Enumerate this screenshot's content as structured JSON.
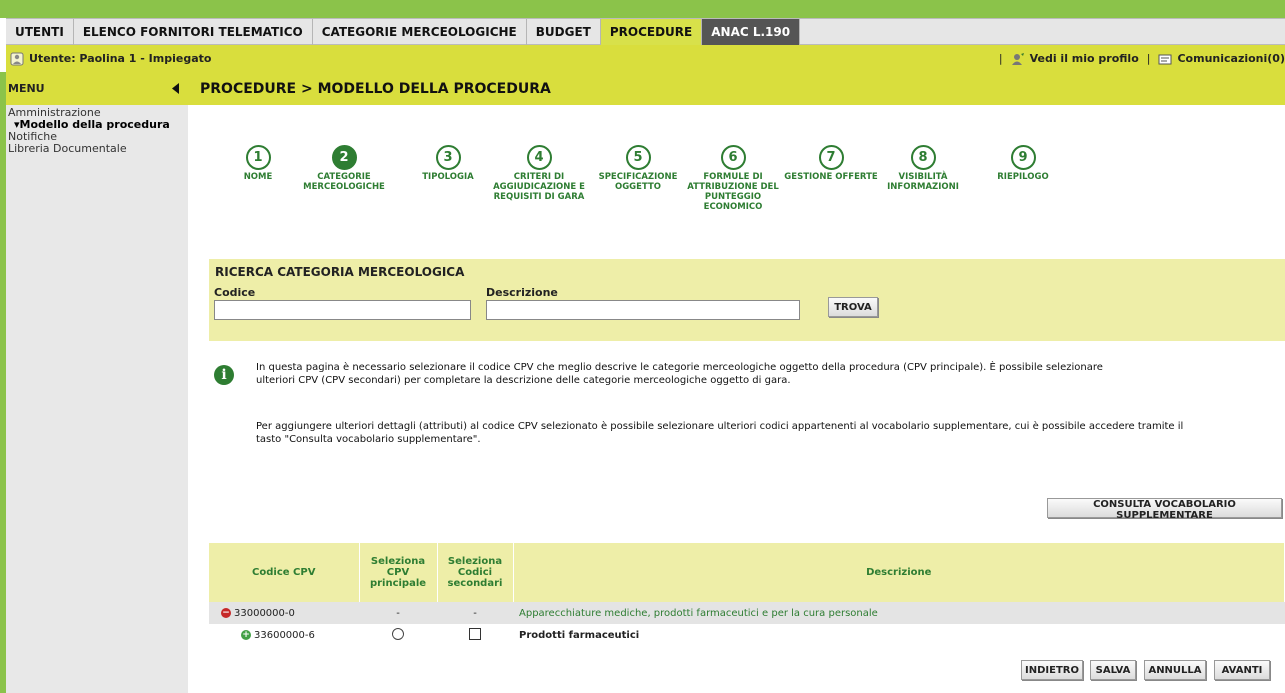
{
  "topnav": {
    "tabs": [
      {
        "label": "UTENTI"
      },
      {
        "label": "ELENCO FORNITORI TELEMATICO"
      },
      {
        "label": "CATEGORIE MERCEOLOGICHE"
      },
      {
        "label": "BUDGET"
      },
      {
        "label": "PROCEDURE"
      },
      {
        "label": "ANAC L.190"
      }
    ]
  },
  "userbar": {
    "user": "Utente: Paolina 1 - Impiegato",
    "profile": "Vedi il mio profilo",
    "messages": "Comunicazioni(0)"
  },
  "sidebar": {
    "menu": "MENU",
    "items": [
      {
        "label": "Amministrazione"
      },
      {
        "label": "▾Modello della procedura"
      },
      {
        "label": "Notifiche"
      },
      {
        "label": "Libreria Documentale"
      }
    ]
  },
  "page": {
    "title": "PROCEDURE  > MODELLO DELLA PROCEDURA"
  },
  "steps": [
    {
      "num": "1",
      "label": "NOME"
    },
    {
      "num": "2",
      "label": "CATEGORIE MERCEOLOGICHE"
    },
    {
      "num": "3",
      "label": "TIPOLOGIA"
    },
    {
      "num": "4",
      "label": "CRITERI DI AGGIUDICAZIONE E REQUISITI DI GARA"
    },
    {
      "num": "5",
      "label": "SPECIFICAZIONE OGGETTO"
    },
    {
      "num": "6",
      "label": "FORMULE DI ATTRIBUZIONE DEL PUNTEGGIO ECONOMICO"
    },
    {
      "num": "7",
      "label": "GESTIONE OFFERTE"
    },
    {
      "num": "8",
      "label": "VISIBILITÀ INFORMAZIONI"
    },
    {
      "num": "9",
      "label": "RIEPILOGO"
    }
  ],
  "search": {
    "title": "RICERCA CATEGORIA MERCEOLOGICA",
    "code_label": "Codice",
    "code_value": "",
    "desc_label": "Descrizione",
    "desc_value": "",
    "button": "TROVA"
  },
  "info": {
    "para1_line1": "In questa pagina è necessario selezionare il codice CPV che meglio descrive le categorie merceologiche oggetto della procedura (CPV principale). È possibile selezionare",
    "para1_line2": "ulteriori CPV (CPV secondari) per completare la descrizione delle categorie merceologiche oggetto di gara.",
    "para2_line1": "Per aggiungere ulteriori dettagli (attributi) al codice CPV selezionato è possibile selezionare ulteriori codici appartenenti al vocabolario supplementare, cui è possibile accedere tramite il",
    "para2_line2": "tasto \"Consulta vocabolario supplementare\"."
  },
  "vocab_button": "CONSULTA VOCABOLARIO SUPPLEMENTARE",
  "table": {
    "headers": {
      "code": "Codice CPV",
      "main": "Seleziona CPV principale",
      "secondary": "Seleziona Codici secondari",
      "desc": "Descrizione"
    },
    "rows": [
      {
        "code": "33000000-0",
        "main": "-",
        "secondary": "-",
        "desc": "Apparecchiature mediche, prodotti farmaceutici e per la cura personale"
      },
      {
        "code": "33600000-6",
        "desc": "Prodotti farmaceutici"
      }
    ]
  },
  "actions": {
    "back": "INDIETRO",
    "save": "SALVA",
    "cancel": "ANNULLA",
    "next": "AVANTI"
  },
  "colors": {
    "accent_green": "#2e7d32",
    "yellow_bar": "#d9de3d",
    "pale_yellow": "#eeeea8"
  }
}
